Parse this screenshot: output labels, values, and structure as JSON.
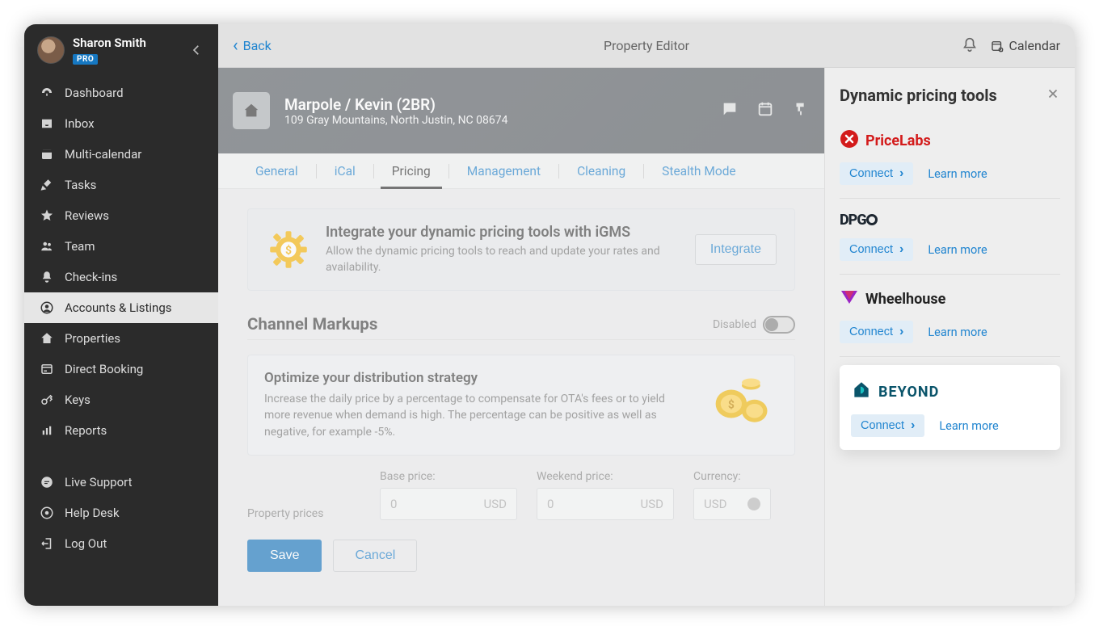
{
  "user": {
    "name": "Sharon Smith",
    "badge": "PRO"
  },
  "sidebar": {
    "items": [
      {
        "label": "Dashboard",
        "icon": "gauge",
        "active": false
      },
      {
        "label": "Inbox",
        "icon": "inbox",
        "active": false
      },
      {
        "label": "Multi-calendar",
        "icon": "calendar",
        "active": false
      },
      {
        "label": "Tasks",
        "icon": "broom",
        "active": false
      },
      {
        "label": "Reviews",
        "icon": "star",
        "active": false
      },
      {
        "label": "Team",
        "icon": "users",
        "active": false
      },
      {
        "label": "Check-ins",
        "icon": "bell",
        "active": false
      },
      {
        "label": "Accounts & Listings",
        "icon": "user-circle",
        "active": true
      },
      {
        "label": "Properties",
        "icon": "home",
        "active": false
      },
      {
        "label": "Direct Booking",
        "icon": "window",
        "active": false
      },
      {
        "label": "Keys",
        "icon": "key",
        "active": false
      },
      {
        "label": "Reports",
        "icon": "chart",
        "active": false
      }
    ],
    "bottom": [
      {
        "label": "Live Support",
        "icon": "chat"
      },
      {
        "label": "Help Desk",
        "icon": "life-ring"
      },
      {
        "label": "Log Out",
        "icon": "signout"
      }
    ]
  },
  "topbar": {
    "back": "Back",
    "title": "Property Editor",
    "calendar_label": "Calendar"
  },
  "property": {
    "title": "Marpole / Kevin (2BR)",
    "address": "109 Gray Mountains, North Justin, NC 08674"
  },
  "tabs": [
    "General",
    "iCal",
    "Pricing",
    "Management",
    "Cleaning",
    "Stealth Mode"
  ],
  "active_tab": "Pricing",
  "integrate_card": {
    "title": "Integrate your dynamic pricing tools with iGMS",
    "subtitle": "Allow the dynamic pricing tools to reach and update your rates and availability.",
    "button": "Integrate"
  },
  "channel_markups": {
    "heading": "Channel Markups",
    "toggle_label": "Disabled",
    "card_title": "Optimize your distribution strategy",
    "card_text": "Increase the daily price by a percentage to compensate for OTA's fees or to yield more revenue when demand is high. The percentage can be positive as well as negative, for example -5%.",
    "labels": {
      "property_prices": "Property prices",
      "base": "Base price:",
      "weekend": "Weekend price:",
      "currency": "Currency:"
    },
    "placeholders": {
      "zero": "0",
      "usd": "USD"
    }
  },
  "buttons": {
    "save": "Save",
    "cancel": "Cancel"
  },
  "right_panel": {
    "title": "Dynamic pricing tools",
    "connect": "Connect",
    "learn": "Learn more",
    "tools": [
      {
        "name": "PriceLabs",
        "highlight": false
      },
      {
        "name": "DPGO",
        "highlight": false
      },
      {
        "name": "Wheelhouse",
        "highlight": false
      },
      {
        "name": "BEYOND",
        "highlight": true
      }
    ]
  }
}
